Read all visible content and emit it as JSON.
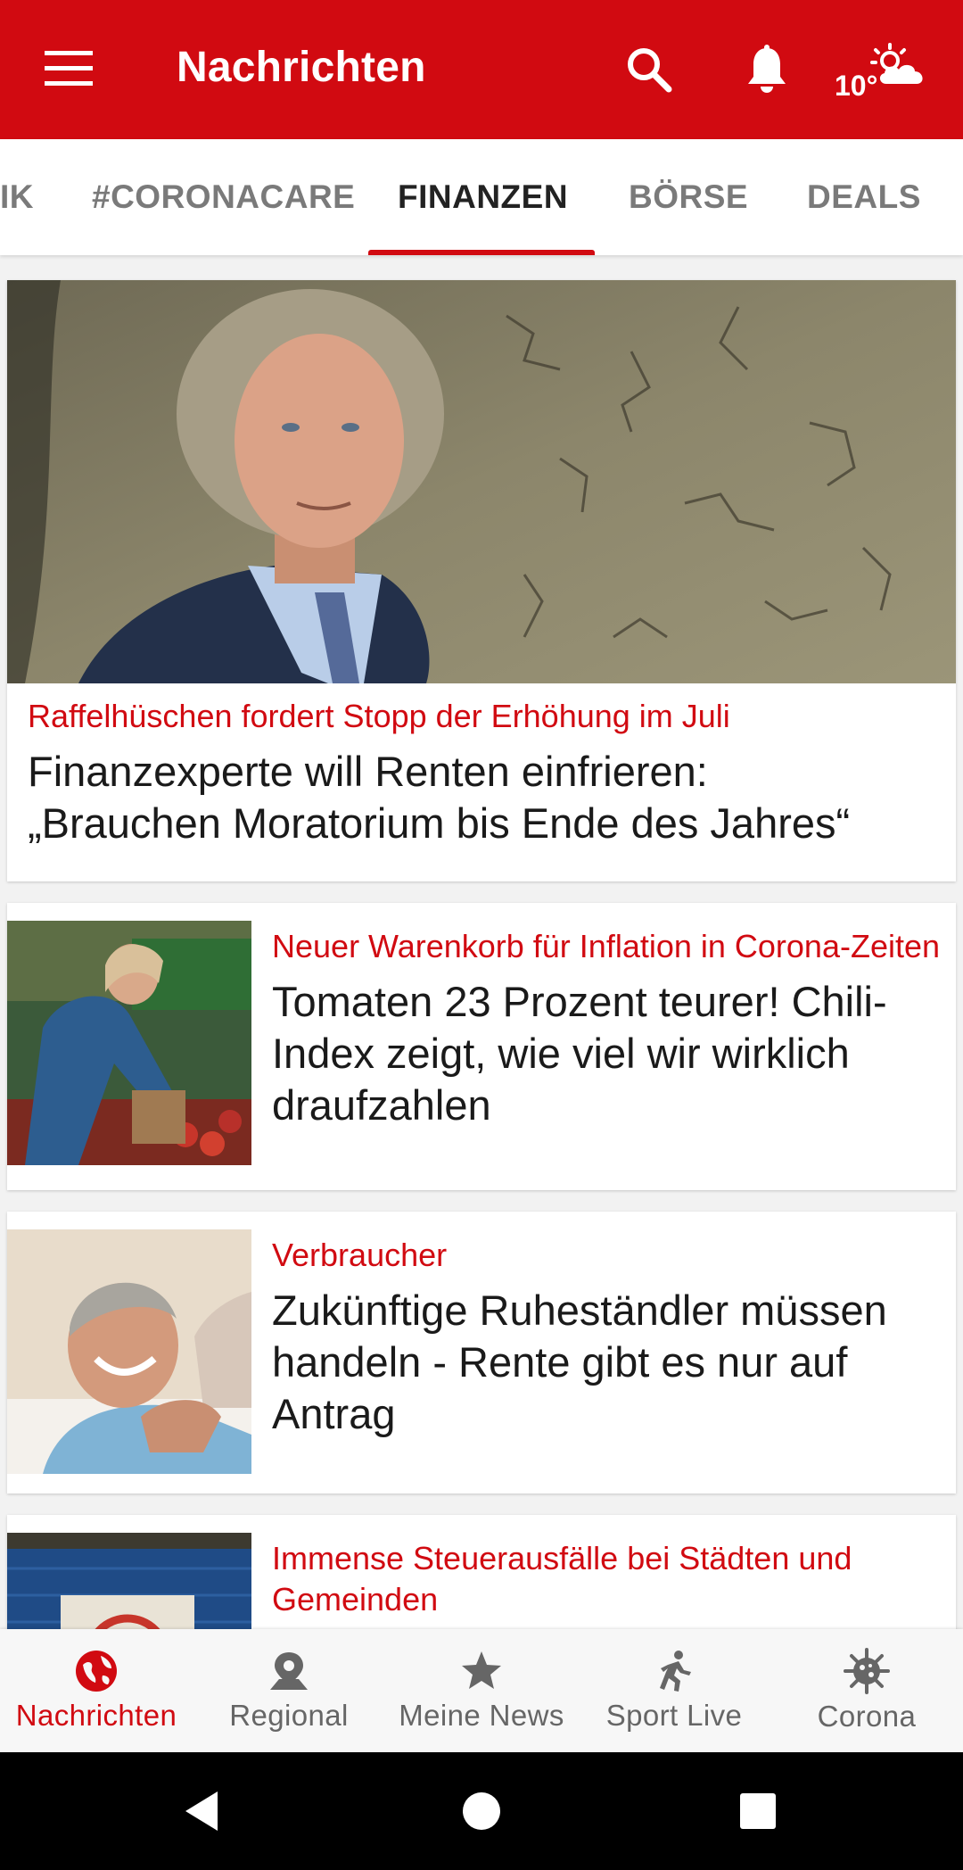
{
  "header": {
    "title": "Nachrichten",
    "weather_temp": "10°",
    "icons": [
      "menu-icon",
      "search-icon",
      "bell-icon",
      "weather-sun-cloud-icon"
    ],
    "accent_color": "#d10a11"
  },
  "tabs": [
    {
      "label": "IK"
    },
    {
      "label": "#CORONACARE"
    },
    {
      "label": "FINANZEN",
      "active": true
    },
    {
      "label": "BÖRSE"
    },
    {
      "label": "DEALS"
    }
  ],
  "articles": [
    {
      "kicker": "Raffelhüschen fordert Stopp der Erhöhung im Juli",
      "headline_line1": "Finanzexperte will Renten einfrieren:",
      "headline_line2": "„Brauchen Moratorium bis Ende des Jahres“"
    },
    {
      "kicker": "Neuer Warenkorb für Inflation in Corona-Zeiten",
      "headline": "Tomaten 23 Prozent teurer! Chili-Index zeigt, wie viel wir wirklich draufzahlen"
    },
    {
      "kicker": "Verbraucher",
      "headline": "Zukünftige Ruheständler müssen handeln - Rente gibt es nur auf Antrag"
    },
    {
      "kicker": "Immense Steuerausfälle bei Städten und Gemeinden"
    }
  ],
  "bottom_nav": [
    {
      "label": "Nachrichten",
      "icon": "globe-icon",
      "active": true
    },
    {
      "label": "Regional",
      "icon": "map-pin-icon"
    },
    {
      "label": "Meine News",
      "icon": "star-icon"
    },
    {
      "label": "Sport Live",
      "icon": "runner-icon"
    },
    {
      "label": "Corona",
      "icon": "virus-icon"
    }
  ],
  "system_nav": [
    "back-icon",
    "home-icon",
    "recents-icon"
  ]
}
